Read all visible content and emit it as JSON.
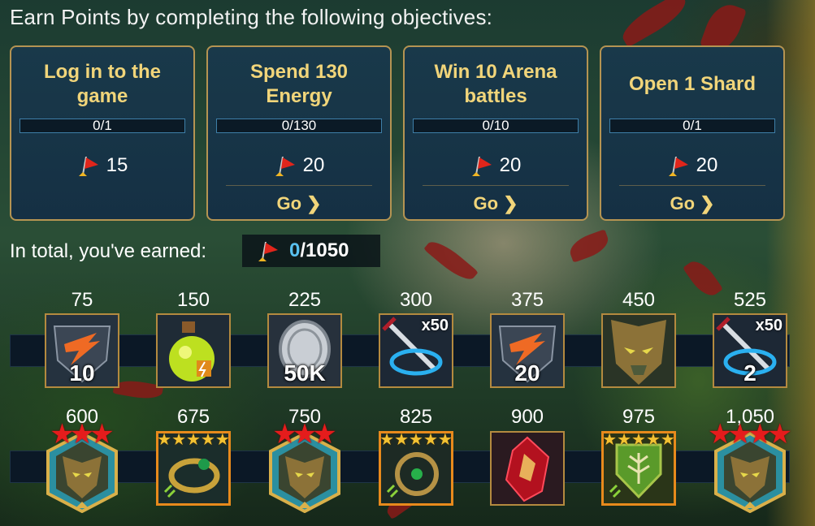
{
  "headline": "Earn Points by completing the following objectives:",
  "colors": {
    "accent_gold": "#f1d57a",
    "progress_blue": "#59c1f0",
    "card_border": "#b59452",
    "epic_orange": "#e88a1c",
    "star_red": "#e51c1c"
  },
  "objectives": [
    {
      "title": "Log in to the game",
      "progress_text": "0/1",
      "progress": 0,
      "reward": "15",
      "reward_icon": "flag-points-icon",
      "go": ""
    },
    {
      "title": "Spend 130 Energy",
      "progress_text": "0/130",
      "progress": 0,
      "reward": "20",
      "reward_icon": "flag-points-icon",
      "go": "Go"
    },
    {
      "title": "Win 10 Arena battles",
      "progress_text": "0/10",
      "progress": 0,
      "reward": "20",
      "reward_icon": "flag-points-icon",
      "go": "Go"
    },
    {
      "title": "Open 1 Shard",
      "progress_text": "0/1",
      "progress": 0,
      "reward": "20",
      "reward_icon": "flag-points-icon",
      "go": "Go"
    }
  ],
  "total": {
    "label": "In total, you've earned:",
    "current": "0",
    "max": "/1050",
    "icon": "flag-points-icon"
  },
  "milestones_row1": [
    {
      "points": "75",
      "item": "energy-refill-icon",
      "qty": "10",
      "mult": ""
    },
    {
      "points": "150",
      "item": "potion-flask-icon",
      "qty": "",
      "mult": ""
    },
    {
      "points": "225",
      "item": "silver-coin-icon",
      "qty": "50K",
      "mult": ""
    },
    {
      "points": "300",
      "item": "sword-multibattle-icon",
      "qty": "",
      "mult": "x50"
    },
    {
      "points": "375",
      "item": "energy-refill-icon",
      "qty": "20",
      "mult": ""
    },
    {
      "points": "450",
      "item": "champion-portrait-icon",
      "qty": "",
      "mult": ""
    },
    {
      "points": "525",
      "item": "sword-multibattle-icon",
      "qty": "2",
      "mult": "x50"
    }
  ],
  "milestones_row2": [
    {
      "points": "600",
      "item": "champion-hex-icon",
      "stars": 3,
      "star_type": "red"
    },
    {
      "points": "675",
      "item": "ring-artifact-icon",
      "stars": 5,
      "star_type": "gold"
    },
    {
      "points": "750",
      "item": "champion-hex-icon",
      "stars": 3,
      "star_type": "red"
    },
    {
      "points": "825",
      "item": "amulet-artifact-icon",
      "stars": 5,
      "star_type": "gold"
    },
    {
      "points": "900",
      "item": "red-crystal-icon",
      "stars": 0,
      "star_type": ""
    },
    {
      "points": "975",
      "item": "shield-artifact-icon",
      "stars": 5,
      "star_type": "gold"
    },
    {
      "points": "1,050",
      "item": "champion-hex-icon",
      "stars": 4,
      "star_type": "red"
    }
  ]
}
